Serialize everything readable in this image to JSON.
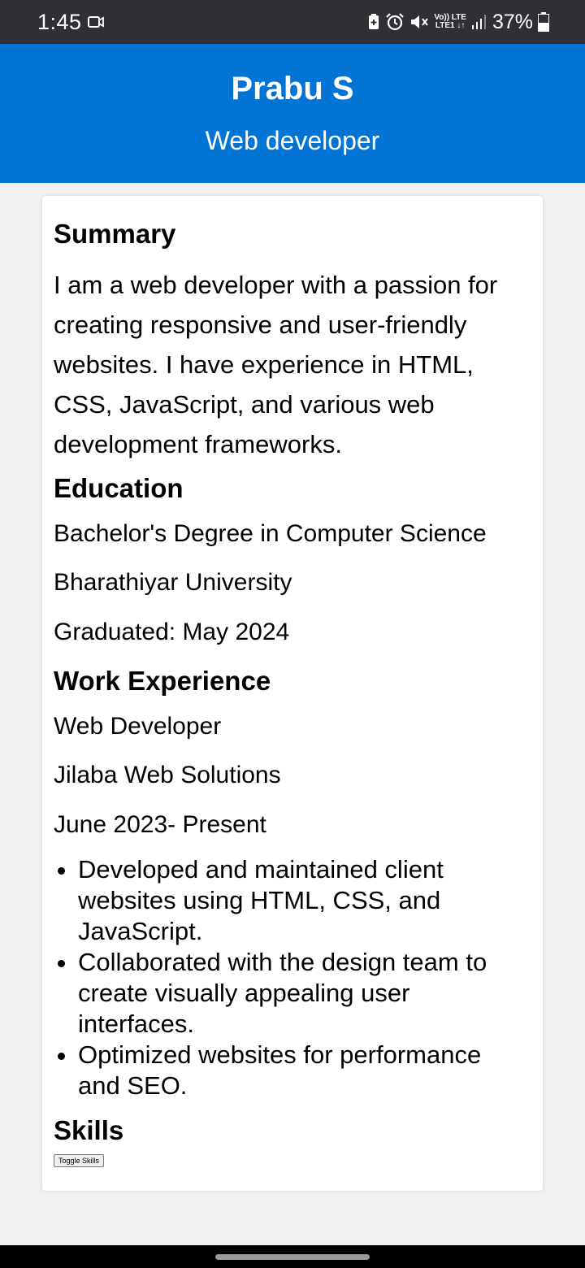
{
  "status_bar": {
    "time": "1:45",
    "network_top": "Vo)) LTE",
    "network_bottom": "LTE1 ↓↑",
    "battery": "37%"
  },
  "header": {
    "name": "Prabu S",
    "role": "Web developer"
  },
  "summary": {
    "heading": "Summary",
    "text": "I am a web developer with a passion for creating responsive and user-friendly websites. I have experience in HTML, CSS, JavaScript, and various web development frameworks."
  },
  "education": {
    "heading": "Education",
    "degree": "Bachelor's Degree in Computer Science",
    "university": "Bharathiyar University",
    "graduated": "Graduated: May 2024"
  },
  "work": {
    "heading": "Work Experience",
    "title": "Web Developer",
    "company": "Jilaba Web Solutions",
    "period": "June 2023- Present",
    "duties": [
      "Developed and maintained client websites using HTML, CSS, and JavaScript.",
      "Collaborated with the design team to create visually appealing user interfaces.",
      "Optimized websites for performance and SEO."
    ]
  },
  "skills": {
    "heading": "Skills",
    "toggle_label": "Toggle Skills"
  },
  "colors": {
    "header_bg": "#0275d4",
    "status_bar_bg": "#2f3033",
    "page_bg": "#f1f1f1"
  }
}
